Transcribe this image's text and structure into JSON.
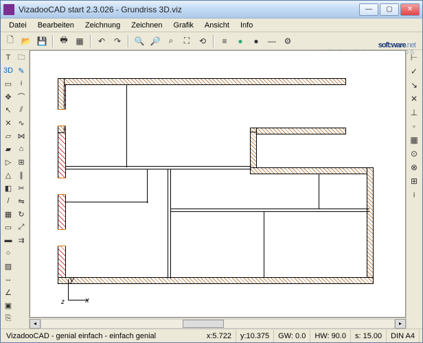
{
  "window": {
    "title": "VizadooCAD start 2.3.026  - Grundriss 3D.viz"
  },
  "menu": {
    "datei": "Datei",
    "bearbeiten": "Bearbeiten",
    "zeichnung": "Zeichnung",
    "zeichnen": "Zeichnen",
    "grafik": "Grafik",
    "ansicht": "Ansicht",
    "info": "Info"
  },
  "watermark": {
    "main_a": "soft",
    "main_b": "ware",
    "main_c": ".net",
    "subtitle": "AKTUELLE DOWNLOADS"
  },
  "axis": {
    "x": "x",
    "y": "y",
    "z": "z"
  },
  "status": {
    "tagline": "VizadooCAD - genial einfach - einfach genial",
    "x_label": "x:",
    "x_value": "5.722",
    "y_label": "y:",
    "y_value": "10.375",
    "gw_label": "GW:",
    "gw_value": "0.0",
    "hw_label": "HW:",
    "hw_value": "90.0",
    "s_label": "s:",
    "s_value": "15.00",
    "format": "DIN A4"
  }
}
